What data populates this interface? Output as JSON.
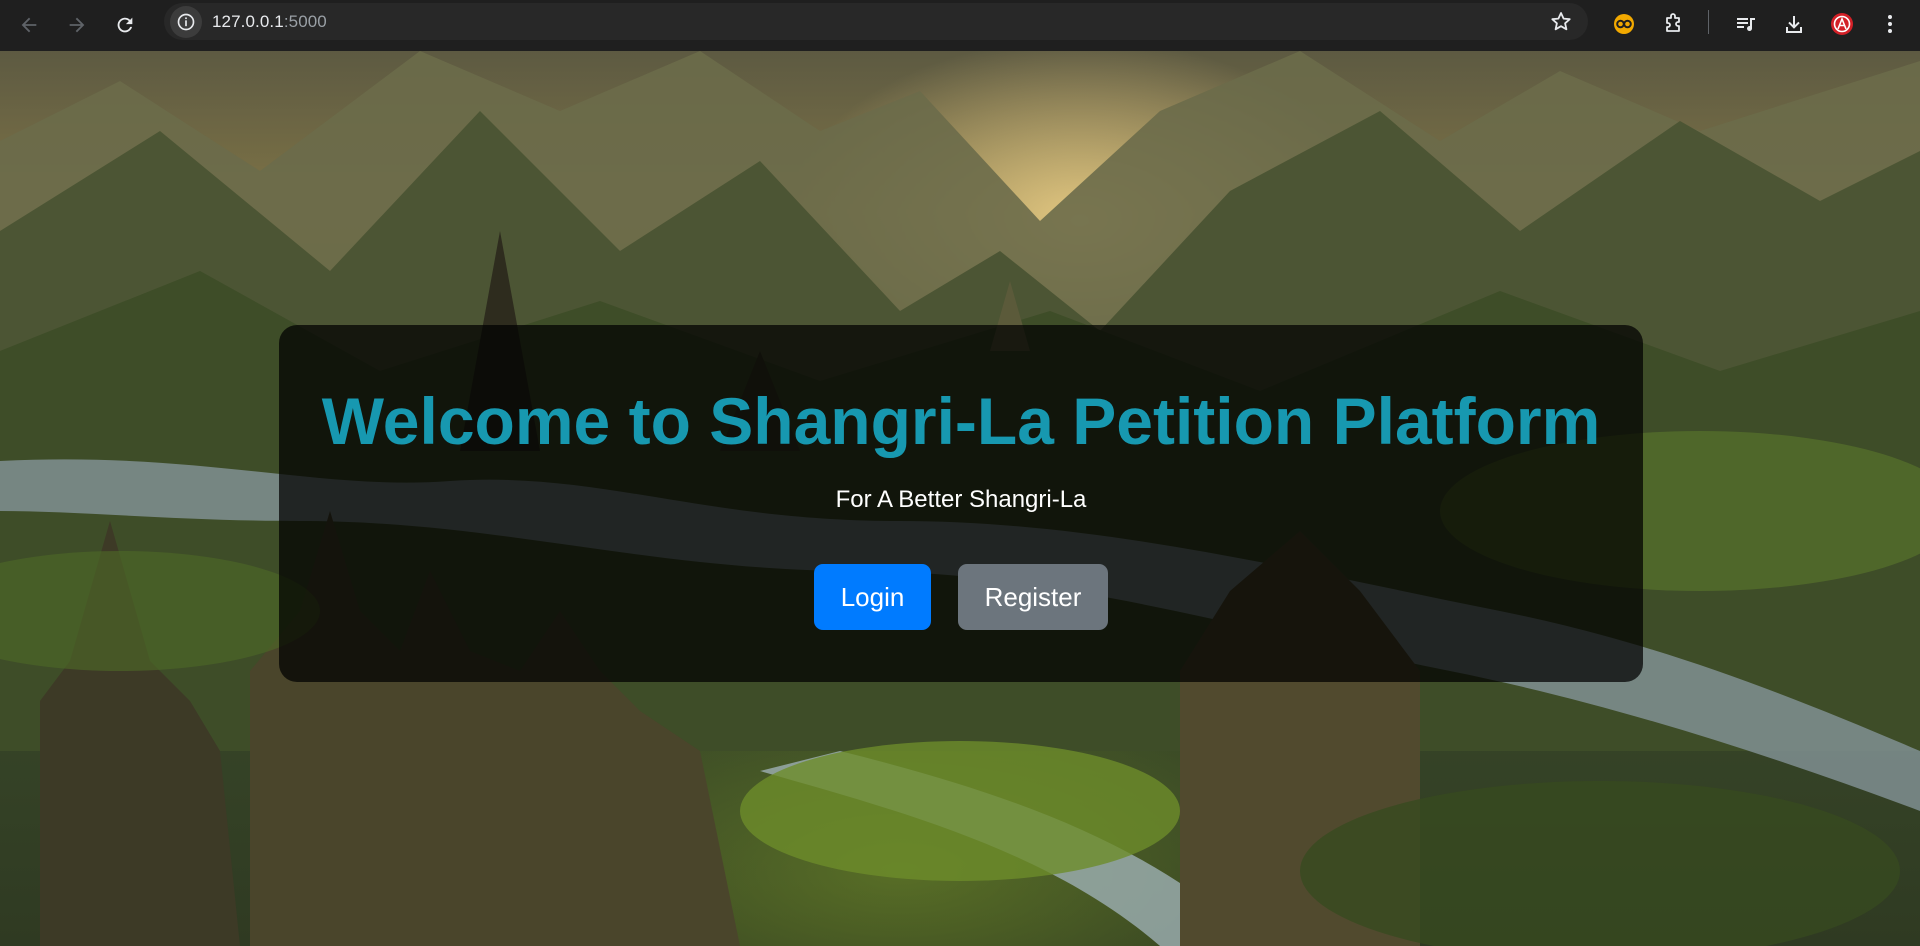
{
  "browser": {
    "url_host": "127.0.0.1",
    "url_port": ":5000",
    "icons": [
      "back-icon",
      "forward-icon",
      "reload-icon",
      "site-info-icon",
      "bookmark-star-icon",
      "extension-colored-icon",
      "extensions-puzzle-icon",
      "media-queue-icon",
      "download-icon",
      "profile-avatar-icon",
      "menu-kebab-icon"
    ]
  },
  "hero": {
    "title": "Welcome to Shangri-La Petition Platform",
    "subtitle": "For A Better Shangri-La",
    "login_label": "Login",
    "register_label": "Register"
  },
  "colors": {
    "title": "#1798b0",
    "login_button": "#007bff",
    "register_button": "#6c757d",
    "card_overlay": "rgba(0,0,0,0.72)"
  }
}
